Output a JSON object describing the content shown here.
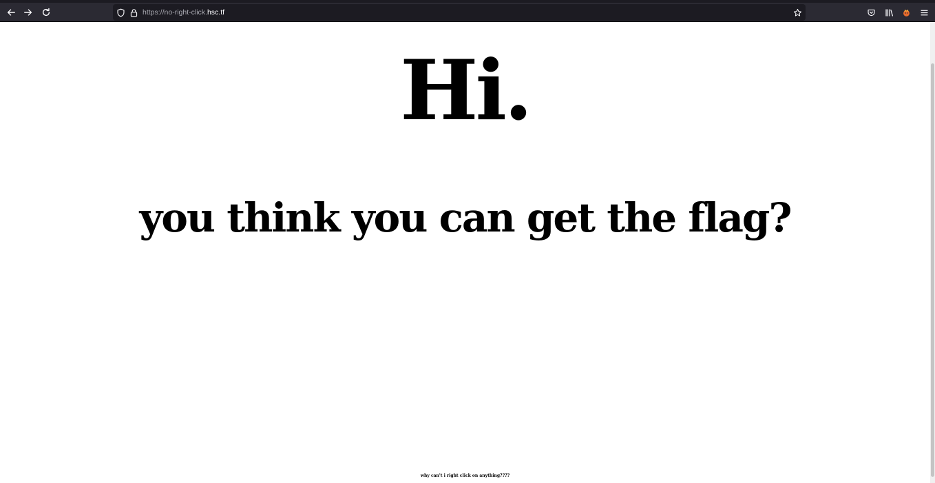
{
  "browser": {
    "url_prefix": "https://no-right-click.",
    "url_host": "hsc.tf",
    "icons": {
      "back": "back-arrow-icon",
      "forward": "forward-arrow-icon",
      "reload": "reload-icon",
      "tracking_protection": "shield-icon",
      "site_security": "lock-icon",
      "bookmark": "star-icon",
      "pocket": "pocket-icon",
      "library": "library-icon",
      "extension": "extension-icon",
      "menu": "hamburger-menu-icon"
    },
    "colors": {
      "toolbar_bg": "#2b2a33",
      "urlbar_bg": "#1c1b22",
      "icon": "#fbfbfe"
    }
  },
  "page": {
    "heading": "Hi.",
    "question": "you think you can get the flag?",
    "footer_note": "why can't i right click on anything????"
  }
}
